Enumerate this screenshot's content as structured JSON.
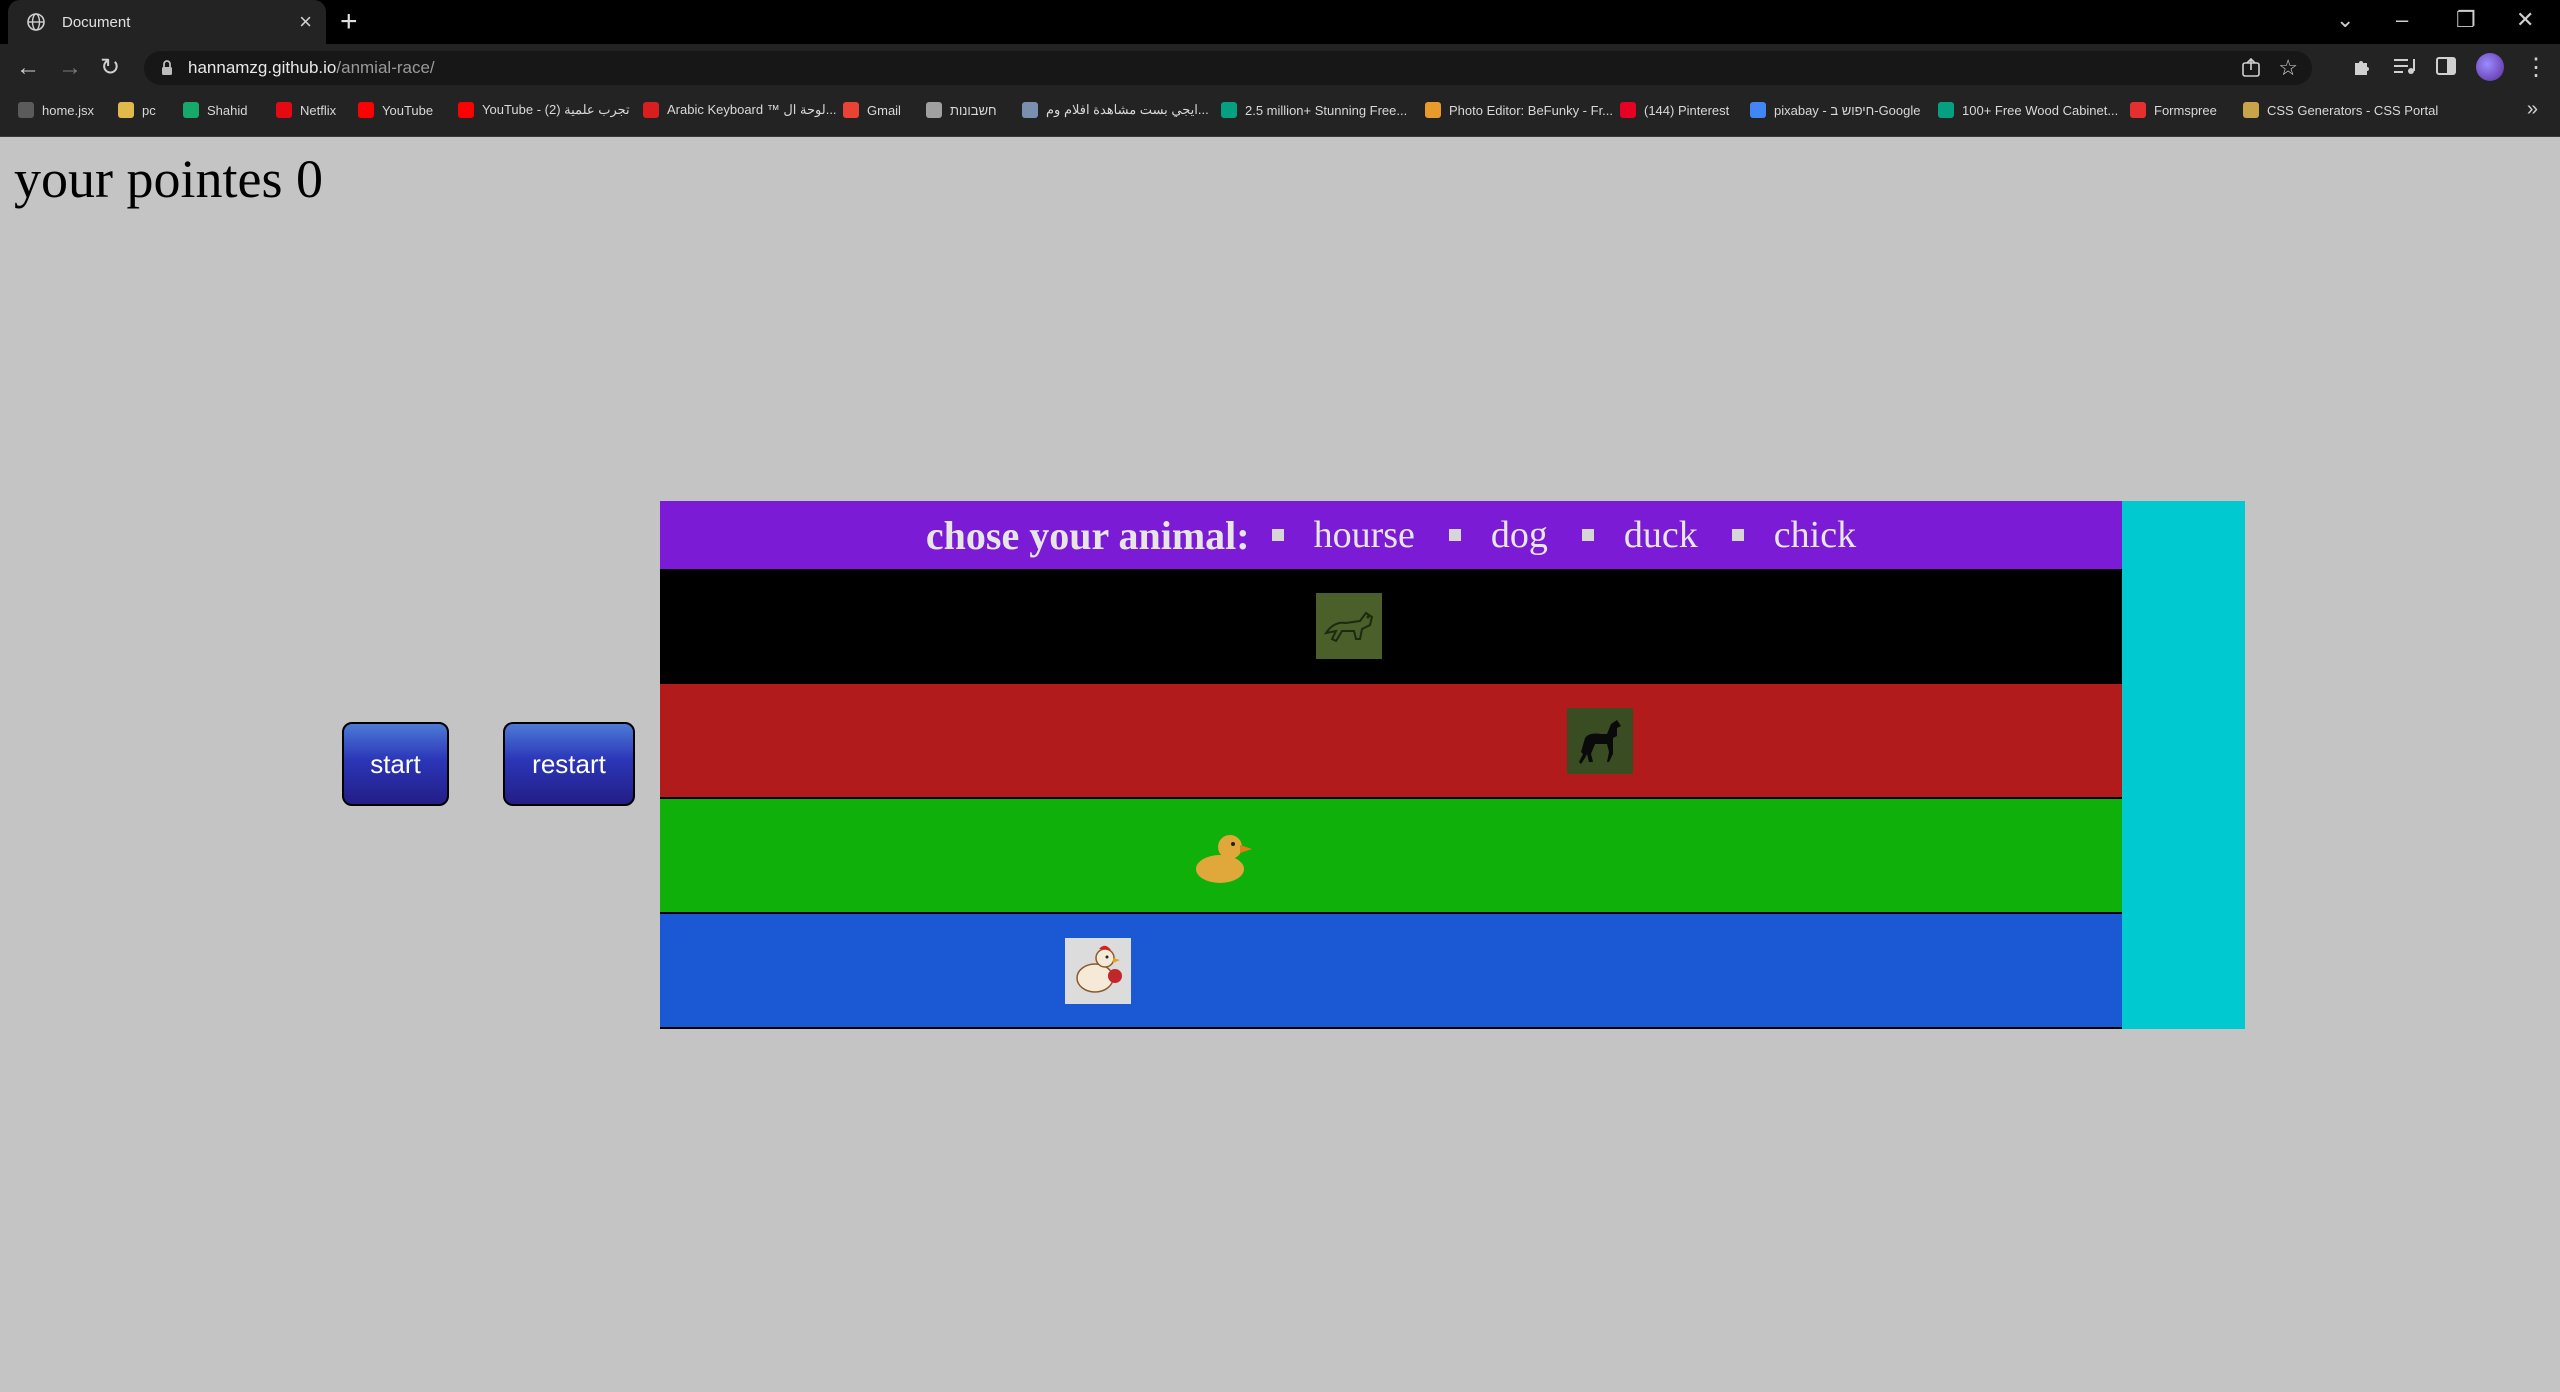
{
  "browser": {
    "tab_title": "Document",
    "url_host": "hannamzg.github.io",
    "url_path": "/anmial-race/",
    "bookmarks": [
      {
        "label": "home.jsx",
        "color": "#5b5b5b"
      },
      {
        "label": "pc",
        "color": "#e0b94a"
      },
      {
        "label": "Shahid",
        "color": "#17a86b"
      },
      {
        "label": "Netflix",
        "color": "#e50914"
      },
      {
        "label": "YouTube",
        "color": "#ff0000"
      },
      {
        "label": "YouTube - تجرب علمية (2)",
        "color": "#ff0000"
      },
      {
        "label": "Arabic Keyboard ™ لوحة ال...",
        "color": "#d81e1e"
      },
      {
        "label": "Gmail",
        "color": "#ea4335"
      },
      {
        "label": "חשבונות",
        "color": "#a0a0a0"
      },
      {
        "label": "ايجي بست مشاهدة افلام وم...",
        "color": "#7a8fb0"
      },
      {
        "label": "2.5 million+ Stunning Free...",
        "color": "#05a081"
      },
      {
        "label": "Photo Editor: BeFunky - Fr...",
        "color": "#e89a2c"
      },
      {
        "label": "(144) Pinterest",
        "color": "#e60023"
      },
      {
        "label": "pixabay - חיפוש ב-Google",
        "color": "#4285f4"
      },
      {
        "label": "100+ Free Wood Cabinet...",
        "color": "#05a081"
      },
      {
        "label": "Formspree",
        "color": "#e5302f"
      },
      {
        "label": "CSS Generators - CSS Portal",
        "color": "#c9a34a"
      }
    ]
  },
  "page": {
    "points_text": "your pointes 0",
    "start_label": "start",
    "restart_label": "restart",
    "choose_label": "chose your animal:",
    "options": [
      "hourse",
      "dog",
      "duck",
      "chick"
    ]
  },
  "lanes": [
    {
      "animal": "dog",
      "color": "#000000",
      "progress": 0.47
    },
    {
      "animal": "hourse",
      "color": "#b11b1b",
      "progress": 0.65
    },
    {
      "animal": "duck",
      "color": "#10b00a",
      "progress": 0.38
    },
    {
      "animal": "chick",
      "color": "#1b58d4",
      "progress": 0.29
    }
  ],
  "colors": {
    "page_bg": "#c4c4c4",
    "header_bg": "#7b1bd6",
    "finish_zone": "#00c9cf",
    "button_top": "#4d7ad6",
    "button_bottom": "#231d86"
  }
}
